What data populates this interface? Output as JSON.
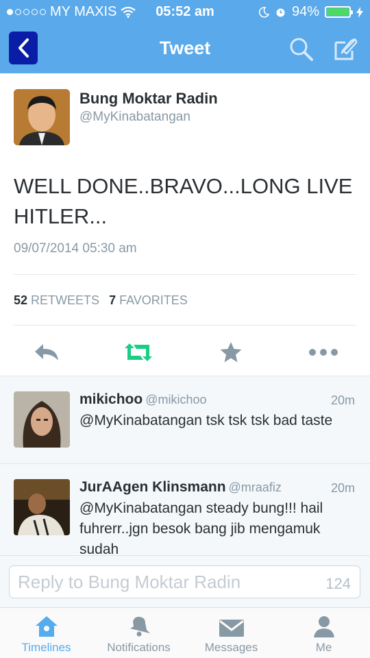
{
  "status_bar": {
    "carrier": "MY MAXIS",
    "time": "05:52 am",
    "battery": "94%",
    "battery_level": 0.94
  },
  "nav": {
    "title": "Tweet",
    "back_icon": "chevron-left-icon",
    "search_icon": "search-icon",
    "compose_icon": "compose-icon"
  },
  "tweet": {
    "author_name": "Bung Moktar Radin",
    "author_handle": "@MyKinabatangan",
    "text": "WELL DONE..BRAVO...LONG LIVE HITLER...",
    "timestamp": "09/07/2014 05:30 am",
    "retweet_count": "52",
    "retweet_label": "RETWEETS",
    "favorite_count": "7",
    "favorite_label": "FAVORITES"
  },
  "actions": [
    "reply-icon",
    "retweet-icon",
    "favorite-star-icon",
    "more-icon"
  ],
  "replies": [
    {
      "name": "mikichoo",
      "handle": "@mikichoo",
      "time": "20m",
      "text": "@MyKinabatangan tsk tsk tsk bad taste"
    },
    {
      "name": "JurAAgen Klinsmann",
      "handle": "@mraafiz",
      "time": "20m",
      "text": "@MyKinabatangan steady bung!!! hail fuhrerr..jgn besok bang jib mengamuk sudah"
    }
  ],
  "reply_box": {
    "placeholder": "Reply to Bung Moktar Radin",
    "char_count": "124"
  },
  "tabs": [
    {
      "label": "Timelines",
      "icon": "home-icon",
      "active": true
    },
    {
      "label": "Notifications",
      "icon": "bell-icon",
      "active": false
    },
    {
      "label": "Messages",
      "icon": "envelope-icon",
      "active": false
    },
    {
      "label": "Me",
      "icon": "person-icon",
      "active": false
    }
  ],
  "colors": {
    "header": "#5aa9ea",
    "accent": "#55acee",
    "retweet_green": "#19cf86",
    "muted": "#8899a6"
  }
}
